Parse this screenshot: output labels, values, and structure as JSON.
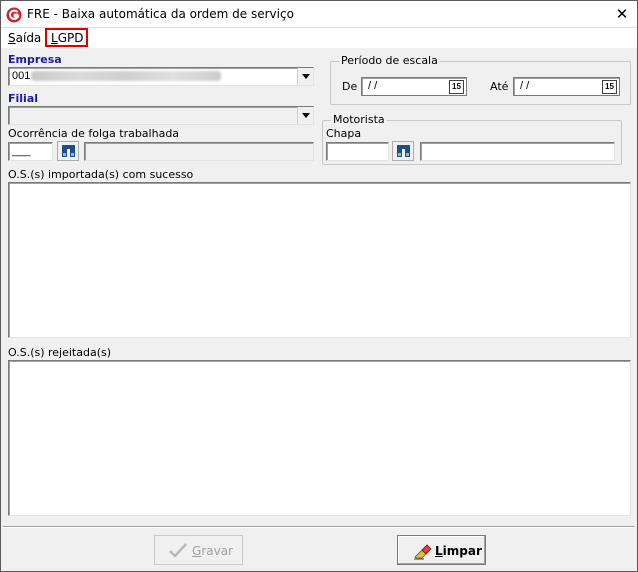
{
  "window": {
    "title": "FRE - Baixa automática da ordem de serviço",
    "close_glyph": "✕"
  },
  "menu": {
    "saida_first": "S",
    "saida_rest": "aída",
    "lgpd_first": "L",
    "lgpd_rest": "GPD"
  },
  "form": {
    "empresa_label": "Empresa",
    "empresa_value": "001",
    "filial_label": "Filial",
    "filial_value": "",
    "ocorrencia_label": "Ocorrência de folga trabalhada",
    "ocorrencia_value": "___",
    "ocorrencia_desc": "",
    "periodo_title": "Período de escala",
    "de_label": "De",
    "de_value": "/ /",
    "ate_label": "Até",
    "ate_value": "/ /",
    "calendar_label": "15",
    "motorista_title": "Motorista",
    "chapa_label": "Chapa",
    "chapa_value": "",
    "motorista_desc": "",
    "importadas_label": "O.S.(s) importada(s) com sucesso",
    "rejeitadas_label": "O.S.(s) rejeitada(s)"
  },
  "buttons": {
    "gravar_first": "G",
    "gravar_rest": "ravar",
    "limpar_first": "L",
    "limpar_rest": "impar"
  },
  "colors": {
    "accent_label": "#1a1aa6",
    "highlight_box": "#e00000",
    "logo_red": "#d42020"
  },
  "icons": {
    "app": "app-logo-icon",
    "close": "close-icon",
    "dropdown": "chevron-down-icon",
    "search": "binoculars-icon",
    "calendar": "calendar-icon",
    "gravar": "checkmark-icon",
    "limpar": "eraser-icon"
  }
}
